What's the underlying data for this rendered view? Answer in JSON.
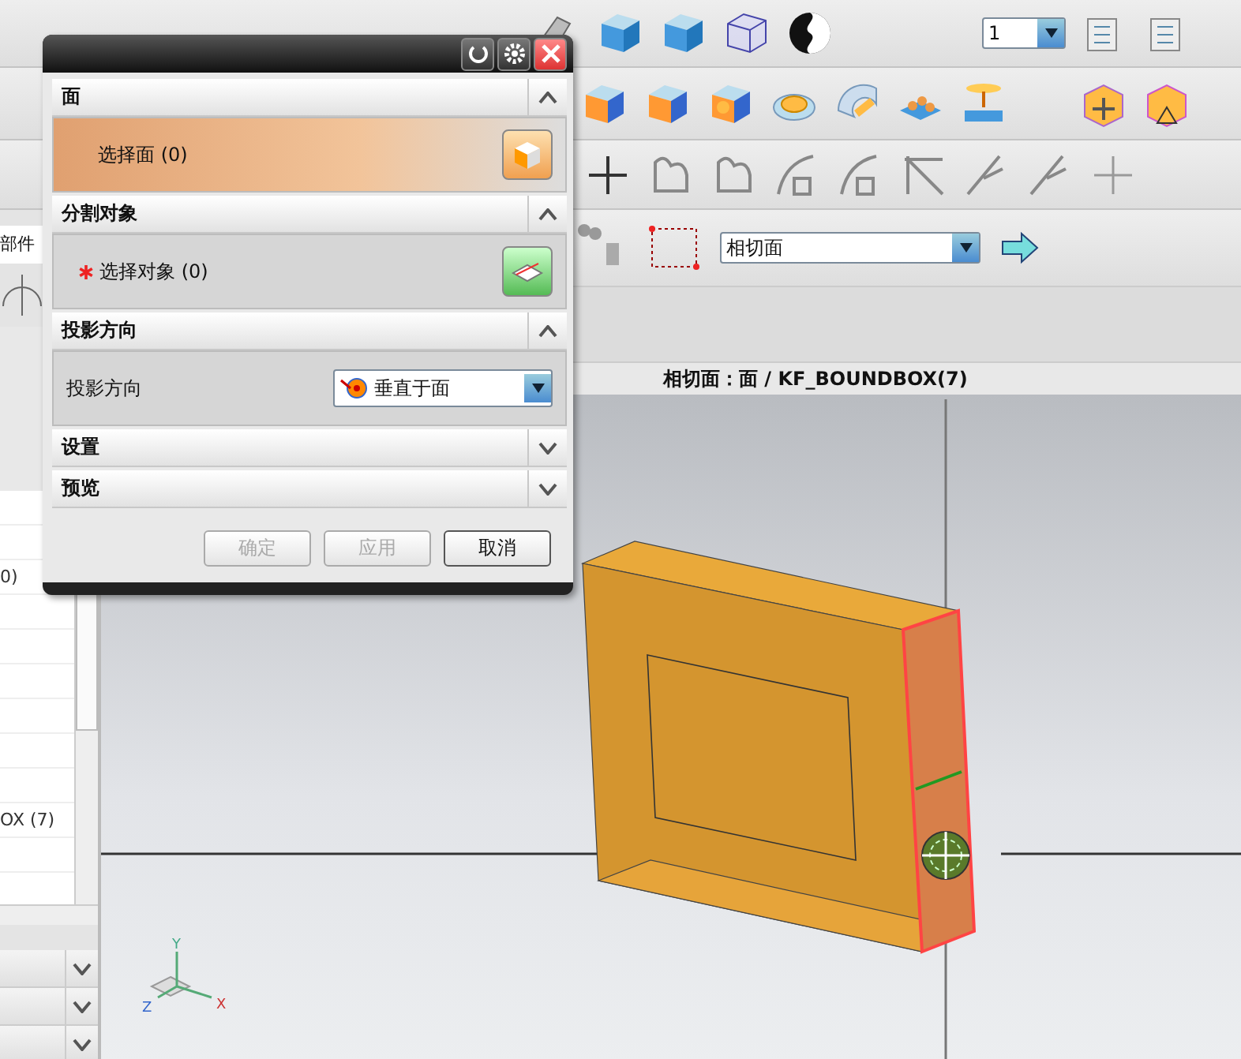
{
  "toolbar": {
    "layer_value": "1"
  },
  "selection_bar": {
    "filter": "相切面"
  },
  "part_navigator": {
    "header": "部件",
    "rows": [
      "0)",
      "OX (7)"
    ],
    "panels": [
      {
        "expanded": false
      },
      {
        "expanded": false
      },
      {
        "expanded": false
      }
    ]
  },
  "viewport": {
    "caption": "相切面：面 / KF_BOUNDBOX(7)",
    "axes": [
      "Y",
      "X",
      "Z"
    ]
  },
  "dialog": {
    "sections": [
      {
        "title": "面",
        "expanded": true,
        "kind": "select",
        "label": "选择面 (0)",
        "required": false,
        "selected": true
      },
      {
        "title": "分割对象",
        "expanded": true,
        "kind": "select",
        "label": "选择对象 (0)",
        "required": true,
        "selected": false
      },
      {
        "title": "投影方向",
        "expanded": true,
        "kind": "dropdown",
        "label": "投影方向",
        "value": "垂直于面"
      },
      {
        "title": "设置",
        "expanded": false
      },
      {
        "title": "预览",
        "expanded": false
      }
    ],
    "buttons": [
      {
        "label": "确定",
        "disabled": true
      },
      {
        "label": "应用",
        "disabled": true
      },
      {
        "label": "取消",
        "disabled": false
      }
    ]
  }
}
